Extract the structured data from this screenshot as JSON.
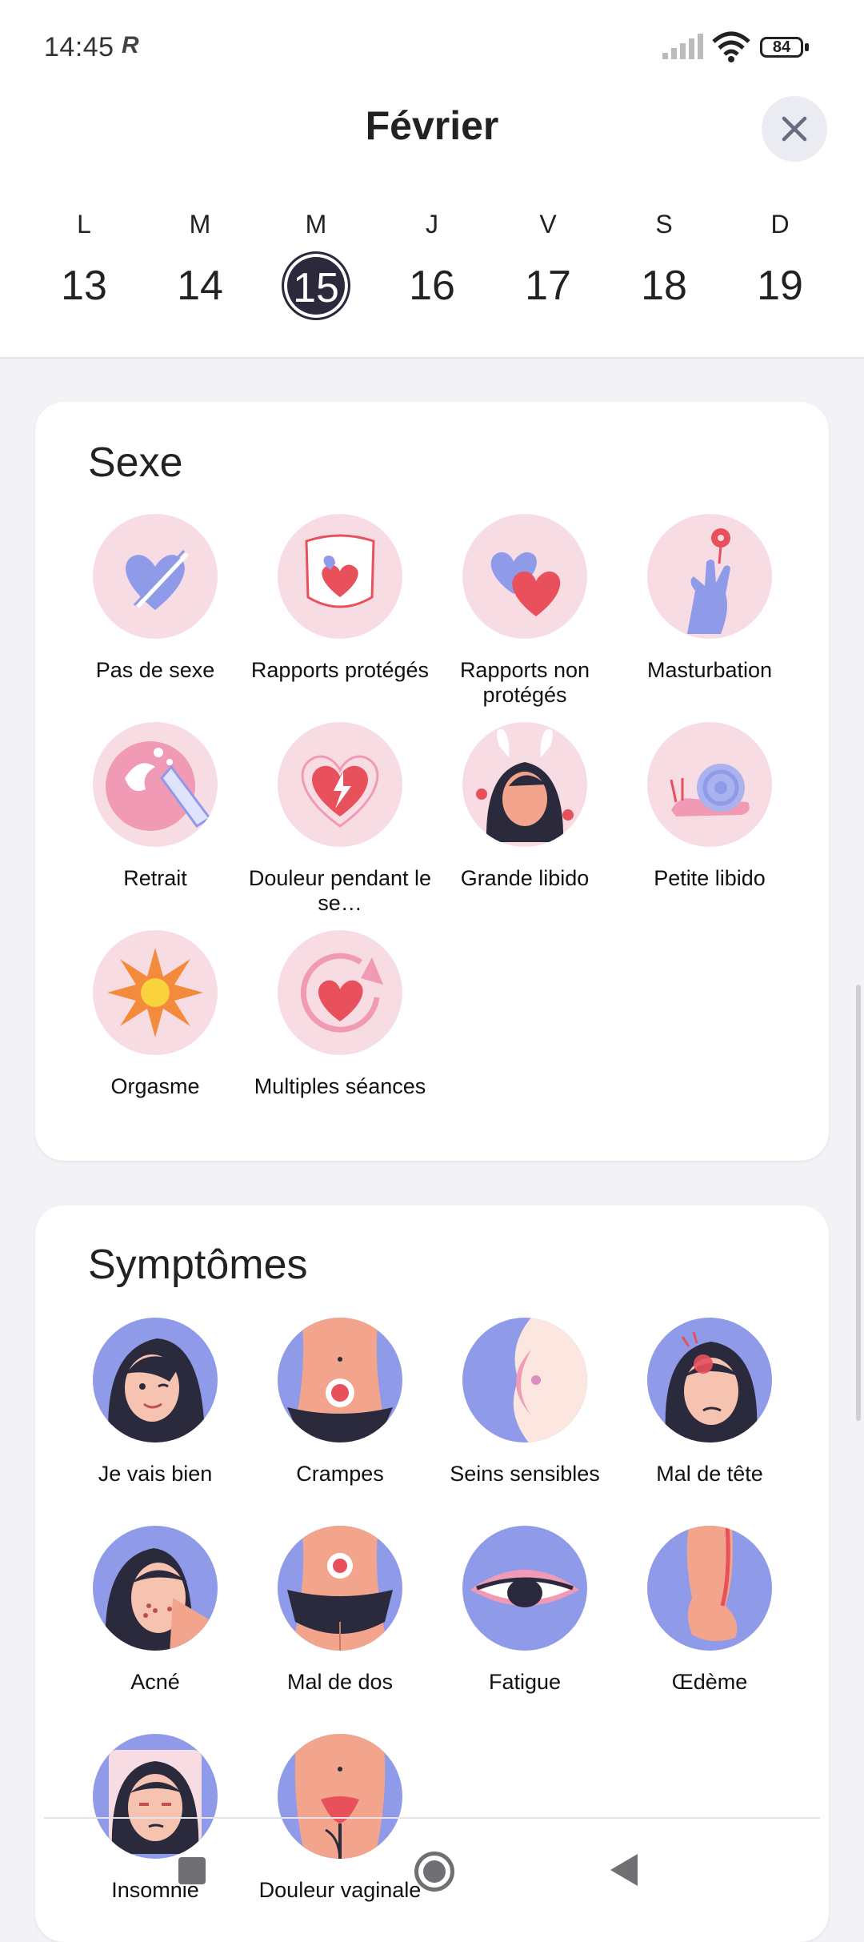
{
  "status_bar": {
    "time": "14:45",
    "time_icon": "R",
    "signal_icon": "signal-icon",
    "wifi_icon": "wifi-icon",
    "battery": "84"
  },
  "header": {
    "title": "Février",
    "close_icon": "close-icon"
  },
  "week": {
    "days": [
      {
        "letter": "L",
        "number": "13"
      },
      {
        "letter": "M",
        "number": "14"
      },
      {
        "letter": "M",
        "number": "15"
      },
      {
        "letter": "J",
        "number": "16"
      },
      {
        "letter": "V",
        "number": "17"
      },
      {
        "letter": "S",
        "number": "18"
      },
      {
        "letter": "D",
        "number": "19"
      }
    ],
    "selected_day": "15"
  },
  "sexe": {
    "title": "Sexe",
    "items": [
      {
        "label": "Pas de sexe",
        "icon": "crossed-heart-icon"
      },
      {
        "label": "Rapports protégés",
        "icon": "shield-heart-icon"
      },
      {
        "label": "Rapports non protégés",
        "icon": "two-hearts-icon"
      },
      {
        "label": "Masturbation",
        "icon": "hand-flower-icon"
      },
      {
        "label": "Retrait",
        "icon": "splash-icon"
      },
      {
        "label": "Douleur pendant le se…",
        "icon": "broken-heart-icon"
      },
      {
        "label": "Grande libido",
        "icon": "bunny-woman-icon"
      },
      {
        "label": "Petite libido",
        "icon": "snail-icon"
      },
      {
        "label": "Orgasme",
        "icon": "burst-icon"
      },
      {
        "label": "Multiples séances",
        "icon": "repeat-heart-icon"
      }
    ]
  },
  "symptomes": {
    "title": "Symptômes",
    "items": [
      {
        "label": "Je vais bien",
        "icon": "happy-face-icon"
      },
      {
        "label": "Crampes",
        "icon": "cramps-icon"
      },
      {
        "label": "Seins sensibles",
        "icon": "breast-icon"
      },
      {
        "label": "Mal de tête",
        "icon": "headache-icon"
      },
      {
        "label": "Acné",
        "icon": "acne-icon"
      },
      {
        "label": "Mal de dos",
        "icon": "back-pain-icon"
      },
      {
        "label": "Fatigue",
        "icon": "tired-eye-icon"
      },
      {
        "label": "Œdème",
        "icon": "swollen-leg-icon"
      },
      {
        "label": "Insomnie",
        "icon": "insomnia-icon"
      },
      {
        "label": "Douleur vaginale",
        "icon": "vaginal-pain-icon"
      }
    ]
  },
  "nav": {
    "recent_icon": "recent-apps-icon",
    "home_icon": "home-icon",
    "back_icon": "back-icon"
  },
  "colors": {
    "accent_dark": "#2b2a3d",
    "pink_bg": "#f7dde3",
    "blue_bg": "#8f9ae8",
    "heart_red": "#e8505b",
    "periwinkle": "#8f9ae8"
  }
}
